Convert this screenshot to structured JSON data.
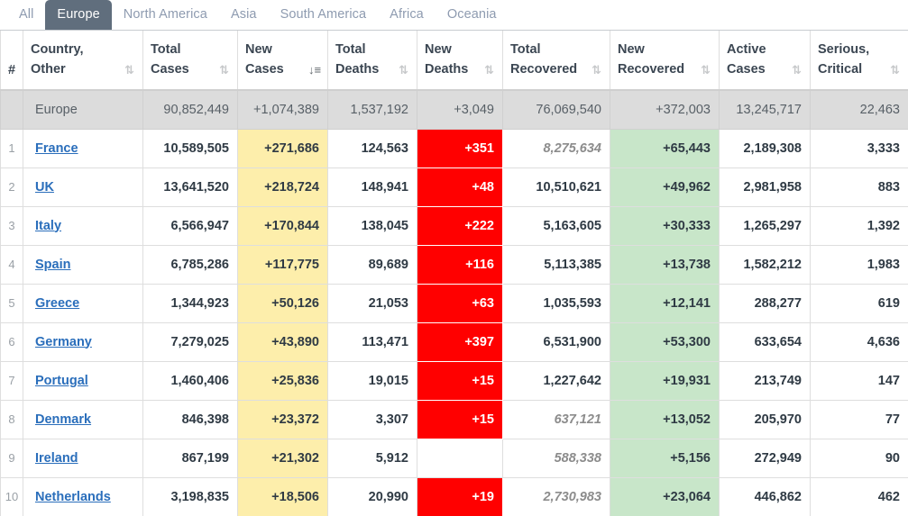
{
  "tabs": [
    {
      "label": "All",
      "active": false
    },
    {
      "label": "Europe",
      "active": true
    },
    {
      "label": "North America",
      "active": false
    },
    {
      "label": "Asia",
      "active": false
    },
    {
      "label": "South America",
      "active": false
    },
    {
      "label": "Africa",
      "active": false
    },
    {
      "label": "Oceania",
      "active": false
    }
  ],
  "table": {
    "columns": [
      {
        "key": "rank",
        "line1": "#",
        "line2": "",
        "sort": "none"
      },
      {
        "key": "country",
        "line1": "Country,",
        "line2": "Other",
        "sort": "both"
      },
      {
        "key": "total_cases",
        "line1": "Total",
        "line2": "Cases",
        "sort": "both"
      },
      {
        "key": "new_cases",
        "line1": "New",
        "line2": "Cases",
        "sort": "desc"
      },
      {
        "key": "total_deaths",
        "line1": "Total",
        "line2": "Deaths",
        "sort": "both"
      },
      {
        "key": "new_deaths",
        "line1": "New",
        "line2": "Deaths",
        "sort": "both"
      },
      {
        "key": "total_recovered",
        "line1": "Total",
        "line2": "Recovered",
        "sort": "both"
      },
      {
        "key": "new_recovered",
        "line1": "New",
        "line2": "Recovered",
        "sort": "both"
      },
      {
        "key": "active_cases",
        "line1": "Active",
        "line2": "Cases",
        "sort": "both"
      },
      {
        "key": "serious_critical",
        "line1": "Serious,",
        "line2": "Critical",
        "sort": "both"
      }
    ],
    "summary": {
      "rank": "",
      "country": "Europe",
      "total_cases": "90,852,449",
      "new_cases": "+1,074,389",
      "total_deaths": "1,537,192",
      "new_deaths": "+3,049",
      "total_recovered": "76,069,540",
      "new_recovered": "+372,003",
      "active_cases": "13,245,717",
      "serious_critical": "22,463"
    },
    "rows": [
      {
        "rank": "1",
        "country": "France",
        "total_cases": "10,589,505",
        "new_cases": "+271,686",
        "total_deaths": "124,563",
        "new_deaths": "+351",
        "total_recovered": "8,275,634",
        "total_recovered_muted": true,
        "new_recovered": "+65,443",
        "active_cases": "2,189,308",
        "serious_critical": "3,333"
      },
      {
        "rank": "2",
        "country": "UK",
        "total_cases": "13,641,520",
        "new_cases": "+218,724",
        "total_deaths": "148,941",
        "new_deaths": "+48",
        "total_recovered": "10,510,621",
        "total_recovered_muted": false,
        "new_recovered": "+49,962",
        "active_cases": "2,981,958",
        "serious_critical": "883"
      },
      {
        "rank": "3",
        "country": "Italy",
        "total_cases": "6,566,947",
        "new_cases": "+170,844",
        "total_deaths": "138,045",
        "new_deaths": "+222",
        "total_recovered": "5,163,605",
        "total_recovered_muted": false,
        "new_recovered": "+30,333",
        "active_cases": "1,265,297",
        "serious_critical": "1,392"
      },
      {
        "rank": "4",
        "country": "Spain",
        "total_cases": "6,785,286",
        "new_cases": "+117,775",
        "total_deaths": "89,689",
        "new_deaths": "+116",
        "total_recovered": "5,113,385",
        "total_recovered_muted": false,
        "new_recovered": "+13,738",
        "active_cases": "1,582,212",
        "serious_critical": "1,983"
      },
      {
        "rank": "5",
        "country": "Greece",
        "total_cases": "1,344,923",
        "new_cases": "+50,126",
        "total_deaths": "21,053",
        "new_deaths": "+63",
        "total_recovered": "1,035,593",
        "total_recovered_muted": false,
        "new_recovered": "+12,141",
        "active_cases": "288,277",
        "serious_critical": "619"
      },
      {
        "rank": "6",
        "country": "Germany",
        "total_cases": "7,279,025",
        "new_cases": "+43,890",
        "total_deaths": "113,471",
        "new_deaths": "+397",
        "total_recovered": "6,531,900",
        "total_recovered_muted": false,
        "new_recovered": "+53,300",
        "active_cases": "633,654",
        "serious_critical": "4,636"
      },
      {
        "rank": "7",
        "country": "Portugal",
        "total_cases": "1,460,406",
        "new_cases": "+25,836",
        "total_deaths": "19,015",
        "new_deaths": "+15",
        "total_recovered": "1,227,642",
        "total_recovered_muted": false,
        "new_recovered": "+19,931",
        "active_cases": "213,749",
        "serious_critical": "147"
      },
      {
        "rank": "8",
        "country": "Denmark",
        "total_cases": "846,398",
        "new_cases": "+23,372",
        "total_deaths": "3,307",
        "new_deaths": "+15",
        "total_recovered": "637,121",
        "total_recovered_muted": true,
        "new_recovered": "+13,052",
        "active_cases": "205,970",
        "serious_critical": "77"
      },
      {
        "rank": "9",
        "country": "Ireland",
        "total_cases": "867,199",
        "new_cases": "+21,302",
        "total_deaths": "5,912",
        "new_deaths": "",
        "total_recovered": "588,338",
        "total_recovered_muted": true,
        "new_recovered": "+5,156",
        "active_cases": "272,949",
        "serious_critical": "90"
      },
      {
        "rank": "10",
        "country": "Netherlands",
        "total_cases": "3,198,835",
        "new_cases": "+18,506",
        "total_deaths": "20,990",
        "new_deaths": "+19",
        "total_recovered": "2,730,983",
        "total_recovered_muted": true,
        "new_recovered": "+23,064",
        "active_cases": "446,862",
        "serious_critical": "462"
      }
    ]
  },
  "colors": {
    "tab_active_bg": "#606e7d",
    "tab_inactive_text": "#8e9bb0",
    "summary_bg": "#dcdcdc",
    "new_cases_bg": "#fdeeab",
    "new_deaths_bg": "#ff0000",
    "new_recovered_bg": "#c8e6c9",
    "link": "#2a6ebb"
  }
}
